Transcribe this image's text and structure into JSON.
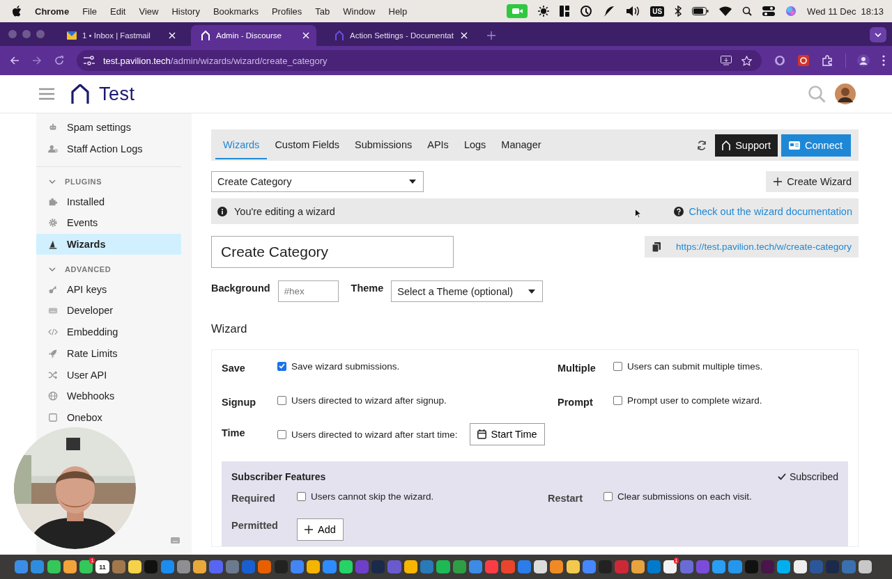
{
  "menubar": {
    "app": "Chrome",
    "menus": [
      "File",
      "Edit",
      "View",
      "History",
      "Bookmarks",
      "Profiles",
      "Tab",
      "Window",
      "Help"
    ],
    "input_source": "US",
    "date": "Wed 11 Dec",
    "time": "18:13"
  },
  "browser": {
    "tabs": [
      {
        "title": "1 • Inbox | Fastmail",
        "selected": false,
        "kind": "mail"
      },
      {
        "title": "Admin - Discourse",
        "selected": true,
        "kind": "discourse"
      },
      {
        "title": "Action Settings - Documentat",
        "selected": false,
        "kind": "discourse"
      }
    ],
    "url_host": "test.pavilion.tech",
    "url_path": "/admin/wizards/wizard/create_category"
  },
  "site": {
    "title": "Test"
  },
  "sidebar": {
    "groups": [
      {
        "items": [
          {
            "label": "Spam settings",
            "selected": false
          },
          {
            "label": "Staff Action Logs",
            "selected": false
          }
        ]
      },
      {
        "title": "PLUGINS",
        "expanded": true,
        "items": [
          {
            "label": "Installed",
            "selected": false
          },
          {
            "label": "Events",
            "selected": false
          },
          {
            "label": "Wizards",
            "selected": true
          }
        ]
      },
      {
        "title": "ADVANCED",
        "expanded": true,
        "items": [
          {
            "label": "API keys",
            "selected": false
          },
          {
            "label": "Developer",
            "selected": false
          },
          {
            "label": "Embedding",
            "selected": false
          },
          {
            "label": "Rate Limits",
            "selected": false
          },
          {
            "label": "User API",
            "selected": false
          },
          {
            "label": "Webhooks",
            "selected": false
          },
          {
            "label": "Onebox",
            "selected": false
          }
        ]
      }
    ]
  },
  "admin_nav": {
    "tabs": [
      {
        "label": "Wizards",
        "selected": true
      },
      {
        "label": "Custom Fields",
        "selected": false
      },
      {
        "label": "Submissions",
        "selected": false
      },
      {
        "label": "APIs",
        "selected": false
      },
      {
        "label": "Logs",
        "selected": false
      },
      {
        "label": "Manager",
        "selected": false
      }
    ],
    "support_button": "Support",
    "connect_button": "Connect"
  },
  "wizard_select": "Create Category",
  "create_wizard_button": "Create Wizard",
  "notice": {
    "text": "You're editing a wizard",
    "doc_link": "Check out the wizard documentation"
  },
  "name_field": {
    "value": "Create Category"
  },
  "wizard_url": "https://test.pavilion.tech/w/create-category",
  "background": {
    "label": "Background",
    "placeholder": "#hex"
  },
  "theme": {
    "label": "Theme",
    "value": "Select a Theme (optional)"
  },
  "section_title": "Wizard",
  "settings": [
    {
      "label": "Save",
      "text": "Save wizard submissions.",
      "checked": true
    },
    {
      "label": "Multiple",
      "text": "Users can submit multiple times.",
      "checked": false
    },
    {
      "label": "Signup",
      "text": "Users directed to wizard after signup.",
      "checked": false
    },
    {
      "label": "Prompt",
      "text": "Prompt user to complete wizard.",
      "checked": false
    },
    {
      "label": "Time",
      "text": "Users directed to wizard after start time:",
      "checked": false,
      "button": "Start Time"
    }
  ],
  "subscriber": {
    "title": "Subscriber Features",
    "status": "Subscribed",
    "settings": [
      {
        "label": "Required",
        "text": "Users cannot skip the wizard.",
        "checked": false
      },
      {
        "label": "Restart",
        "text": "Clear submissions on each visit.",
        "checked": false
      }
    ],
    "permitted": {
      "label": "Permitted",
      "button": "Add"
    }
  },
  "dock": {
    "apps": [
      {
        "color": "#3b8ee8"
      },
      {
        "color": "#2f8de0"
      },
      {
        "color": "#34c759"
      },
      {
        "color": "#f2a33a"
      },
      {
        "color": "#34c759",
        "badge": "1"
      },
      {
        "color": "#ffffff",
        "label": "11"
      },
      {
        "color": "#a0784c"
      },
      {
        "color": "#f5d24a"
      },
      {
        "color": "#111111"
      },
      {
        "color": "#1b8cf0"
      },
      {
        "color": "#8e8e93"
      },
      {
        "color": "#e8a93a"
      },
      {
        "color": "#5865f2"
      },
      {
        "color": "#6b7a8f"
      },
      {
        "color": "#1a5fd0"
      },
      {
        "color": "#e66000"
      },
      {
        "color": "#222222"
      },
      {
        "color": "#4285f4"
      },
      {
        "color": "#f4b400"
      },
      {
        "color": "#2d8cff"
      },
      {
        "color": "#25d366"
      },
      {
        "color": "#6e40c9"
      },
      {
        "color": "#1b2a4a"
      },
      {
        "color": "#6a5acd"
      },
      {
        "color": "#f7b500"
      },
      {
        "color": "#2a7ab8"
      },
      {
        "color": "#1db954"
      },
      {
        "color": "#2e9e44"
      },
      {
        "color": "#3c8ce7"
      },
      {
        "color": "#fc3c44"
      },
      {
        "color": "#e8452c"
      },
      {
        "color": "#2b7de9"
      },
      {
        "color": "#dcdcdc"
      },
      {
        "color": "#f08a24"
      },
      {
        "color": "#f2c94c"
      },
      {
        "color": "#4687ff"
      },
      {
        "color": "#222222"
      },
      {
        "color": "#cc2936"
      },
      {
        "color": "#e7a33e"
      },
      {
        "color": "#007acc"
      },
      {
        "color": "#f2f2f2",
        "badge": "1"
      },
      {
        "color": "#6b6bd6"
      },
      {
        "color": "#7b4cd9"
      },
      {
        "color": "#2a9df4"
      },
      {
        "color": "#2496ed"
      },
      {
        "color": "#111111"
      },
      {
        "color": "#4a154b"
      },
      {
        "color": "#00aff0"
      },
      {
        "color": "#eeeeee"
      },
      {
        "color": "#2b579a"
      },
      {
        "color": "#1b2a4a"
      },
      {
        "color": "#3a6fb0"
      },
      {
        "color": "#c8c8c8"
      }
    ]
  }
}
